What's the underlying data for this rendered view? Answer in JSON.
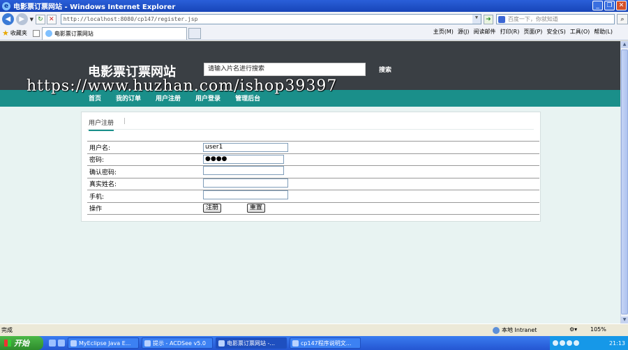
{
  "window": {
    "title": "电影票订票网站 - Windows Internet Explorer",
    "minimize": "_",
    "maximize": "❐",
    "close": "✕"
  },
  "address": {
    "url": "http://localhost:8080/cp147/register.jsp",
    "search_placeholder": "百度一下，你就知道"
  },
  "favorites": {
    "label": "收藏夹",
    "tab_title": "电影票订票网站"
  },
  "commands": [
    "主页(M)",
    "源(J)",
    "阅读邮件",
    "打印(R)",
    "页面(P)",
    "安全(S)",
    "工具(O)",
    "帮助(L)"
  ],
  "site": {
    "title": "电影票订票网站",
    "search_value": "请输入片名进行搜索",
    "search_button": "搜索",
    "watermark": "https://www.huzhan.com/ishop39397",
    "nav": [
      "首页",
      "我的订单",
      "用户注册",
      "用户登录",
      "管理后台"
    ]
  },
  "panel": {
    "tab": "用户注册",
    "tab_sep": "|",
    "fields": [
      {
        "label": "用户名:",
        "value": "user1"
      },
      {
        "label": "密码:",
        "value": "●●●●"
      },
      {
        "label": "确认密码:",
        "value": ""
      },
      {
        "label": "真实姓名:",
        "value": ""
      },
      {
        "label": "手机:",
        "value": ""
      }
    ],
    "action_label": "操作",
    "submit": "注册",
    "reset": "重置"
  },
  "status": {
    "text": "完成",
    "zone": "本地 Intranet",
    "zoom": "105%"
  },
  "taskbar": {
    "start": "开始",
    "tasks": [
      "MyEclipse Java E...",
      "提示 - ACDSee v5.0",
      "电影票订票网站 -...",
      "cp147程序说明文..."
    ],
    "clock": "21:13"
  }
}
